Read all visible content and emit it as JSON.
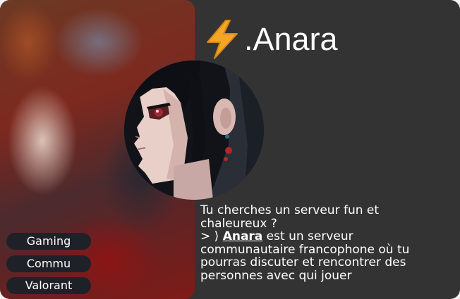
{
  "profile": {
    "title": ".Anara",
    "title_icon": "lightning-bolt-icon",
    "avatar": "anime-girl-profile-avatar"
  },
  "tags": [
    {
      "label": "Gaming"
    },
    {
      "label": "Commu"
    },
    {
      "label": "Valorant"
    }
  ],
  "description": {
    "line1": "Tu cherches un serveur fun et",
    "line2": "chaleureux ?",
    "prefix": "> ⟩ ",
    "server_name": "Anara",
    "line3_rest": " est un serveur",
    "line4": "communautaire francophone où tu",
    "line5": "pourras discuter et rencontrer des",
    "line6": "personnes avec qui jouer"
  },
  "colors": {
    "card_background": "#333333",
    "tag_background": "#1f2128",
    "text": "#ffffff",
    "bolt": "#f5a623"
  }
}
